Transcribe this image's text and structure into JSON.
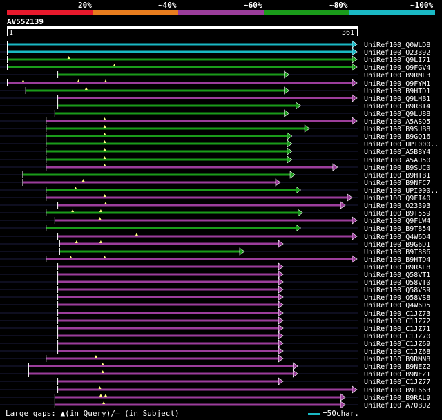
{
  "legend": {
    "segments": [
      {
        "label": "20%",
        "color": "#e8192c"
      },
      {
        "label": "~40%",
        "color": "#e87d1e"
      },
      {
        "label": "~60%",
        "color": "#9b3d9b"
      },
      {
        "label": "~80%",
        "color": "#1a9b1a"
      },
      {
        "label": "~100%",
        "color": "#1ab8c4"
      }
    ]
  },
  "query": {
    "name": "AV552139",
    "start": "1",
    "end": "361"
  },
  "hits": [
    {
      "id": "UniRef100_Q0WLD8",
      "start": 1,
      "end": 361,
      "color": "#1ab8c4",
      "marks": []
    },
    {
      "id": "UniRef100_O23392",
      "start": 1,
      "end": 361,
      "color": "#1ab8c4",
      "marks": []
    },
    {
      "id": "UniRef100_Q9LI71",
      "start": 1,
      "end": 361,
      "color": "#1a9b1a",
      "marks": [
        64
      ]
    },
    {
      "id": "UniRef100_Q9FGV4",
      "start": 1,
      "end": 361,
      "color": "#1a9b1a",
      "marks": [
        111
      ]
    },
    {
      "id": "UniRef100_B9RML3",
      "start": 53,
      "end": 291,
      "color": "#1a9b1a",
      "marks": []
    },
    {
      "id": "UniRef100_Q9FYM1",
      "start": 1,
      "end": 361,
      "color": "#9b3d9b",
      "marks": [
        17,
        74,
        102
      ]
    },
    {
      "id": "UniRef100_B9HTD1",
      "start": 20,
      "end": 291,
      "color": "#1a9b1a",
      "marks": [
        82
      ]
    },
    {
      "id": "UniRef100_Q9LHB1",
      "start": 53,
      "end": 361,
      "color": "#9b3d9b",
      "marks": []
    },
    {
      "id": "UniRef100_B9R8I4",
      "start": 53,
      "end": 303,
      "color": "#1a9b1a",
      "marks": []
    },
    {
      "id": "UniRef100_Q9LU88",
      "start": 50,
      "end": 291,
      "color": "#1a9b1a",
      "marks": []
    },
    {
      "id": "UniRef100_A5ASQ5",
      "start": 41,
      "end": 361,
      "color": "#9b3d9b",
      "marks": [
        101
      ]
    },
    {
      "id": "UniRef100_B9SUB8",
      "start": 41,
      "end": 312,
      "color": "#1a9b1a",
      "marks": [
        101
      ]
    },
    {
      "id": "UniRef100_B9GQ16",
      "start": 41,
      "end": 294,
      "color": "#1a9b1a",
      "marks": [
        101
      ]
    },
    {
      "id": "UniRef100_UPI000..",
      "start": 41,
      "end": 294,
      "color": "#1a9b1a",
      "marks": [
        101
      ]
    },
    {
      "id": "UniRef100_A5B8Y4",
      "start": 41,
      "end": 294,
      "color": "#1a9b1a",
      "marks": [
        101
      ]
    },
    {
      "id": "UniRef100_A5AU50",
      "start": 41,
      "end": 294,
      "color": "#1a9b1a",
      "marks": [
        101
      ]
    },
    {
      "id": "UniRef100_B9SUC0",
      "start": 41,
      "end": 341,
      "color": "#9b3d9b",
      "marks": [
        101
      ]
    },
    {
      "id": "UniRef100_B9HTB1",
      "start": 17,
      "end": 297,
      "color": "#1a9b1a",
      "marks": []
    },
    {
      "id": "UniRef100_B9NFC7",
      "start": 17,
      "end": 282,
      "color": "#9b3d9b",
      "marks": [
        79
      ]
    },
    {
      "id": "UniRef100_UPI000..",
      "start": 41,
      "end": 303,
      "color": "#1a9b1a",
      "marks": [
        71
      ]
    },
    {
      "id": "UniRef100_Q9FI40",
      "start": 41,
      "end": 356,
      "color": "#9b3d9b",
      "marks": [
        101
      ]
    },
    {
      "id": "UniRef100_O23393",
      "start": 53,
      "end": 349,
      "color": "#9b3d9b",
      "marks": [
        102
      ]
    },
    {
      "id": "UniRef100_B9T559",
      "start": 41,
      "end": 305,
      "color": "#1a9b1a",
      "marks": [
        68,
        97
      ]
    },
    {
      "id": "UniRef100_Q9FLW4",
      "start": 50,
      "end": 361,
      "color": "#9b3d9b",
      "marks": [
        96
      ]
    },
    {
      "id": "UniRef100_B9T854",
      "start": 41,
      "end": 303,
      "color": "#1a9b1a",
      "marks": []
    },
    {
      "id": "UniRef100_Q4W6D4",
      "start": 53,
      "end": 361,
      "color": "#9b3d9b",
      "marks": [
        134
      ]
    },
    {
      "id": "UniRef100_B9G6D1",
      "start": 55,
      "end": 285,
      "color": "#9b3d9b",
      "marks": [
        72,
        97
      ]
    },
    {
      "id": "UniRef100_B9T886",
      "start": 55,
      "end": 245,
      "color": "#1a9b1a",
      "marks": []
    },
    {
      "id": "UniRef100_B9HTD4",
      "start": 41,
      "end": 361,
      "color": "#9b3d9b",
      "marks": [
        66,
        101
      ]
    },
    {
      "id": "UniRef100_B9RAL8",
      "start": 53,
      "end": 285,
      "color": "#9b3d9b",
      "marks": []
    },
    {
      "id": "UniRef100_Q58VT1",
      "start": 53,
      "end": 285,
      "color": "#9b3d9b",
      "marks": []
    },
    {
      "id": "UniRef100_Q58VT0",
      "start": 53,
      "end": 285,
      "color": "#9b3d9b",
      "marks": []
    },
    {
      "id": "UniRef100_Q58VS9",
      "start": 53,
      "end": 285,
      "color": "#9b3d9b",
      "marks": []
    },
    {
      "id": "UniRef100_Q58VS8",
      "start": 53,
      "end": 285,
      "color": "#9b3d9b",
      "marks": []
    },
    {
      "id": "UniRef100_Q4W6D5",
      "start": 53,
      "end": 285,
      "color": "#9b3d9b",
      "marks": []
    },
    {
      "id": "UniRef100_C1JZ73",
      "start": 53,
      "end": 285,
      "color": "#9b3d9b",
      "marks": []
    },
    {
      "id": "UniRef100_C1JZ72",
      "start": 53,
      "end": 285,
      "color": "#9b3d9b",
      "marks": []
    },
    {
      "id": "UniRef100_C1JZ71",
      "start": 53,
      "end": 285,
      "color": "#9b3d9b",
      "marks": []
    },
    {
      "id": "UniRef100_C1JZ70",
      "start": 53,
      "end": 285,
      "color": "#9b3d9b",
      "marks": []
    },
    {
      "id": "UniRef100_C1JZ69",
      "start": 53,
      "end": 285,
      "color": "#9b3d9b",
      "marks": []
    },
    {
      "id": "UniRef100_C1JZ68",
      "start": 53,
      "end": 285,
      "color": "#9b3d9b",
      "marks": []
    },
    {
      "id": "UniRef100_B9RMN8",
      "start": 41,
      "end": 285,
      "color": "#9b3d9b",
      "marks": [
        92
      ]
    },
    {
      "id": "UniRef100_B9NEZ2",
      "start": 23,
      "end": 300,
      "color": "#9b3d9b",
      "marks": [
        99
      ]
    },
    {
      "id": "UniRef100_B9NEZ1",
      "start": 23,
      "end": 300,
      "color": "#9b3d9b",
      "marks": [
        99
      ]
    },
    {
      "id": "UniRef100_C1JZ77",
      "start": 53,
      "end": 285,
      "color": "#9b3d9b",
      "marks": []
    },
    {
      "id": "UniRef100_B9T663",
      "start": 53,
      "end": 361,
      "color": "#9b3d9b",
      "marks": [
        96
      ]
    },
    {
      "id": "UniRef100_B9RAL9",
      "start": 50,
      "end": 349,
      "color": "#9b3d9b",
      "marks": [
        97,
        102
      ]
    },
    {
      "id": "UniRef100_A7QBU2",
      "start": 50,
      "end": 349,
      "color": "#9b3d9b",
      "marks": [
        100
      ]
    }
  ],
  "footer": {
    "text": "Large gaps: ▲(in Query)/— (in Subject)",
    "scale_label": "=50char.",
    "scale_color": "#1ab8c4"
  }
}
